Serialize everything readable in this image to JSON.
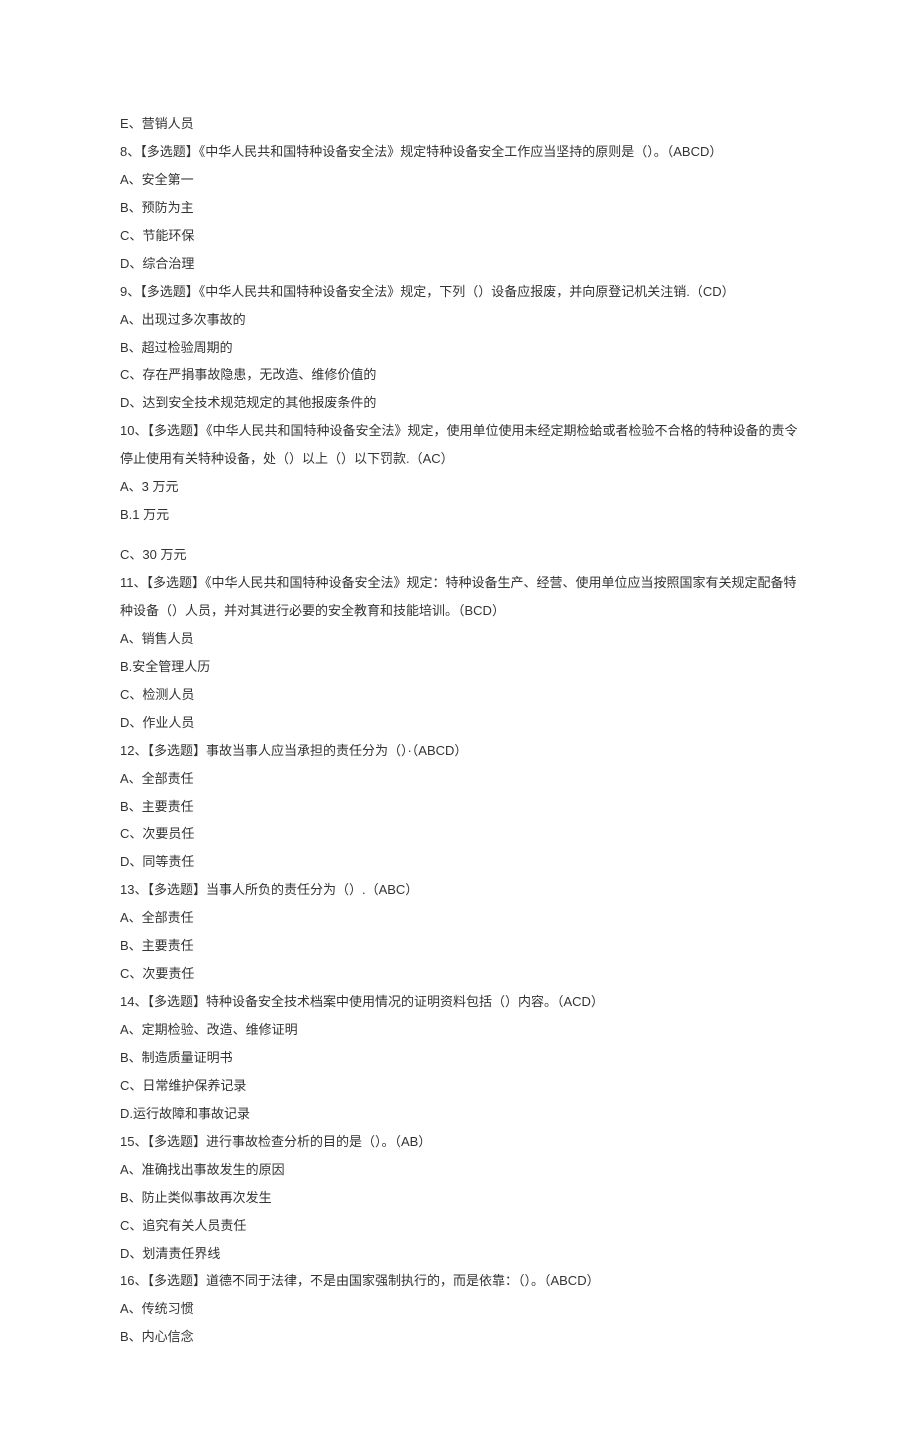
{
  "lines": [
    "E、营销人员",
    "8、【多选题】《中华人民共和国特种设备安全法》规定特种设备安全工作应当坚持的原则是（）。（ABCD）",
    "A、安全第一",
    "B、预防为主",
    "C、节能环保",
    "D、综合治理",
    "9、【多选题】《中华人民共和国特种设备安全法》规定，下列（）设备应报废，并向原登记机关注销.（CD）",
    "A、出现过多次事故的",
    "B、超过检验周期的",
    "C、存在严捐事故隐患，无改造、维修价值的",
    "D、达到安全技术规范规定的其他报废条件的",
    "10、【多选题】《中华人民共和国特种设备安全法》规定，使用单位使用未经定期检蛤或者检验不合格的特种设备的责令停止使用有关特种设备，处（）以上（）以下罚款.（AC）",
    "A、3 万元",
    "B.1 万元"
  ],
  "lines2": [
    "C、30 万元",
    "11、【多选题】《中华人民共和国特种设备安全法》规定：特种设备生产、经营、使用单位应当按照国家有关规定配备特种设备（）人员，并对其进行必要的安全教育和技能培训。（BCD）",
    "A、销售人员",
    "B.安全管理人历",
    "C、检测人员",
    "D、作业人员",
    "12、【多选题】事故当事人应当承担的责任分为（）·（ABCD）",
    "A、全部责任",
    "B、主要责任",
    "C、次要员任",
    "D、同等责任",
    "13、【多选题】当事人所负的责任分为（）.（ABC）",
    "A、全部责任",
    "B、主要责任",
    "C、次要责任",
    "14、【多选题】特种设备安全技术档案中使用情况的证明资料包括（）内容。（ACD）",
    "A、定期检验、改造、维修证明",
    "B、制造质量证明书",
    "C、日常维护保养记录",
    "D.运行故障和事故记录",
    "15、【多选题】进行事故检查分析的目的是（）。（AB）",
    "A、准确找出事故发生的原因",
    "B、防止类似事故再次发生",
    "C、追究有关人员责任",
    "D、划清责任界线",
    "16、【多选题】道德不同于法律，不是由国家强制执行的，而是依靠：（）。（ABCD）",
    "A、传统习惯",
    "B、内心信念"
  ]
}
